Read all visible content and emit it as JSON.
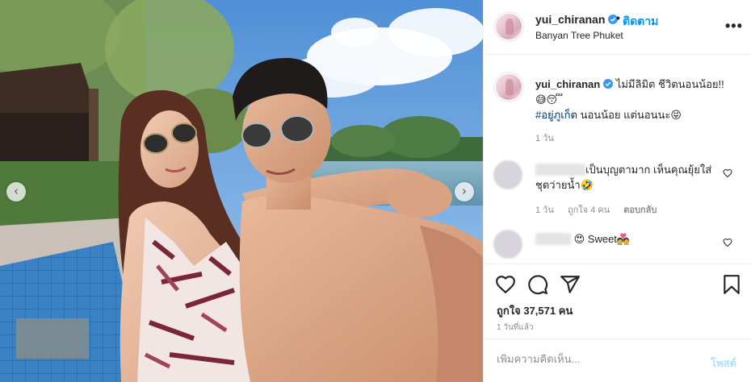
{
  "colors": {
    "accent": "#0095f6",
    "text": "#262626",
    "muted": "#8e8e8e",
    "hashtag": "#00376b",
    "post_disabled": "#b2dffc"
  },
  "media": {
    "prev_icon": "chevron-left-icon",
    "next_icon": "chevron-right-icon",
    "prev_glyph": "‹",
    "next_glyph": "›"
  },
  "header": {
    "username": "yui_chiranan",
    "separator": "•",
    "follow_label": "ติดตาม",
    "location": "Banyan Tree Phuket",
    "more_glyph": "•••"
  },
  "caption": {
    "username": "yui_chiranan",
    "line1": "ไม่มีลิมิต ชีวิตนอนน้อย!!",
    "emoji_line": "😅😴",
    "hashtag": "#อยู่ภูเก็ต",
    "line3_rest": " นอนน้อย แต่นอนนะ😝",
    "time": "1 วัน"
  },
  "comments": [
    {
      "text": "เป็นบุญตามาก เห็นคุณยุ้ยใส่ชุดว่ายน้ำ🤣",
      "time": "1 วัน",
      "likes": "ถูกใจ 4 คน",
      "reply": "ตอบกลับ"
    },
    {
      "text": "😍 Sweet💑"
    }
  ],
  "actions": {
    "like_icon": "heart-icon",
    "comment_icon": "comment-icon",
    "share_icon": "share-icon",
    "save_icon": "bookmark-icon",
    "likes_text": "ถูกใจ 37,571 คน",
    "posted_ago": "1 วันที่แล้ว"
  },
  "add_comment": {
    "placeholder": "เพิ่มความคิดเห็น...",
    "post_label": "โพสต์"
  }
}
